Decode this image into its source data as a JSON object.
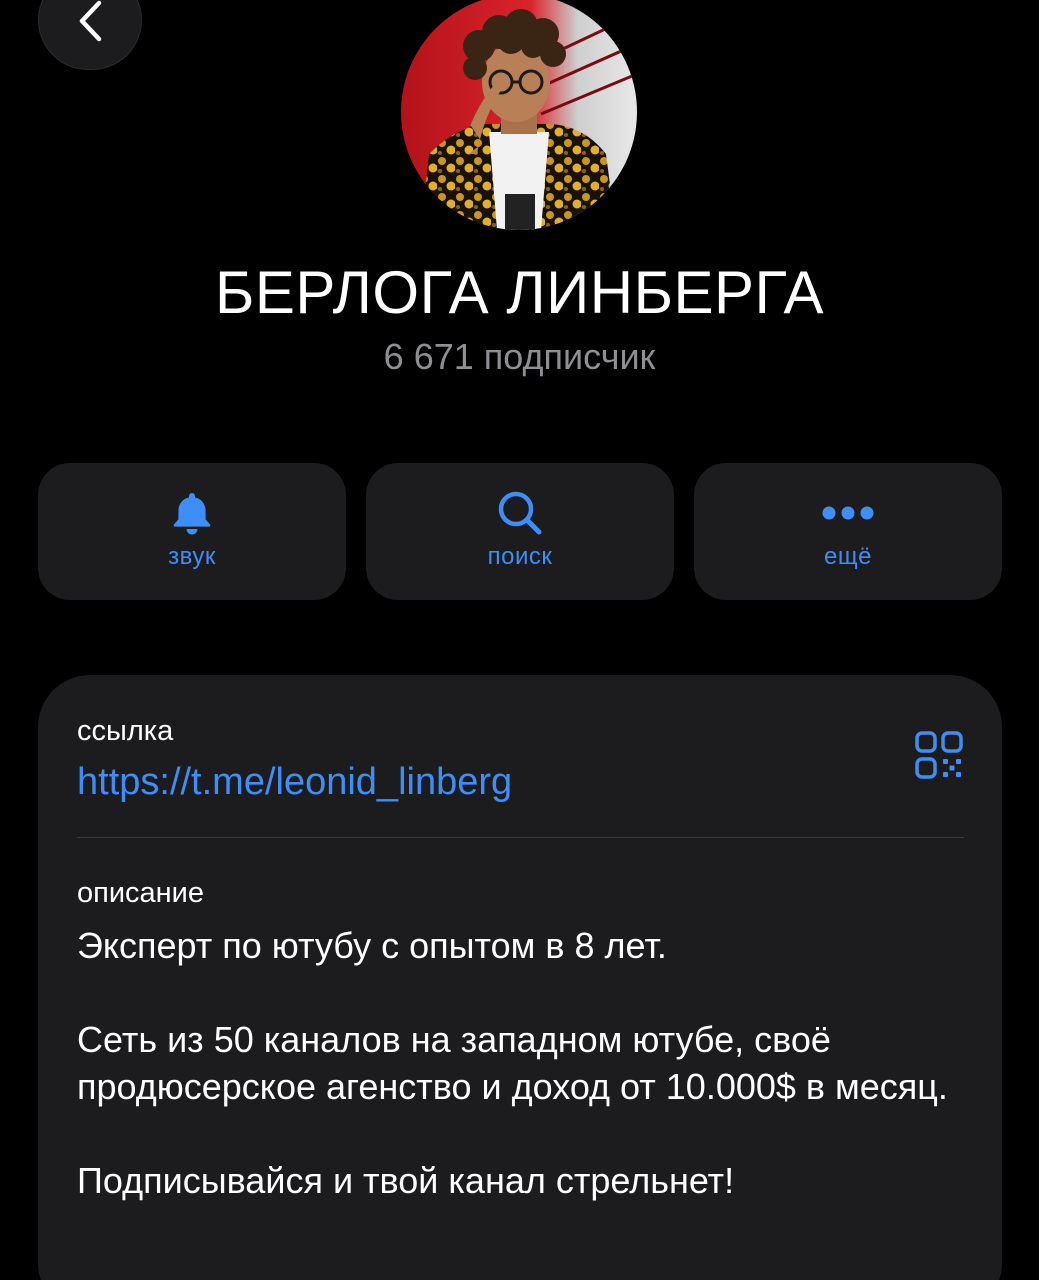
{
  "header": {
    "back_icon": "chevron-left-icon"
  },
  "profile": {
    "avatar": "channel-avatar-photo",
    "title": "БЕРЛОГА ЛИНБЕРГА",
    "subscribers": "6 671 подписчик"
  },
  "actions": [
    {
      "label": "звук",
      "icon": "bell-icon"
    },
    {
      "label": "поиск",
      "icon": "search-icon"
    },
    {
      "label": "ещё",
      "icon": "more-dots-icon"
    }
  ],
  "info": {
    "link_label": "ссылка",
    "link_value": "https://t.me/leonid_linberg",
    "qr_icon": "qr-code-icon",
    "description_label": "описание",
    "description_paragraphs": [
      "Эксперт по ютубу с опытом в 8 лет.",
      "Сеть из 50 каналов на западном ютубе, своё продюсерское агенство и доход от 10.000$ в месяц.",
      "Подписывайся и твой канал стрельнет!"
    ]
  },
  "colors": {
    "background": "#000000",
    "card": "#1c1c1e",
    "accent": "#3e8ef7",
    "secondary_text": "#8e8e93"
  }
}
